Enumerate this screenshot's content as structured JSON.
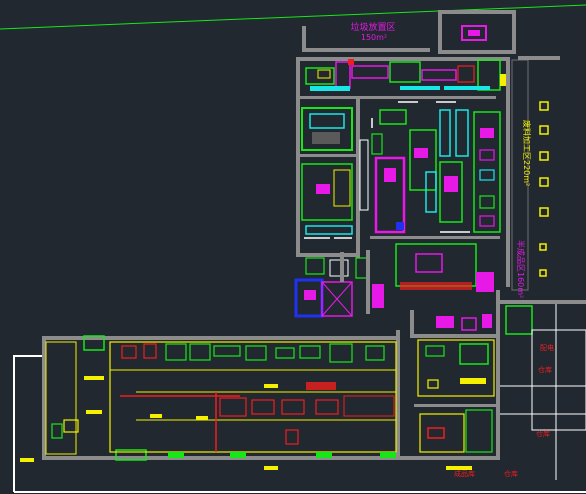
{
  "canvas": {
    "background": "#212830",
    "palette": {
      "wall": "#8c8c8c",
      "green": "#19e619",
      "yellow": "#f5f000",
      "magenta": "#e619e6",
      "cyan": "#19e6e6",
      "red": "#f01e1e",
      "white": "#ffffff",
      "blue": "#1e32f0",
      "grey_line": "#6e6e6e"
    }
  },
  "labels": {
    "waste_zone_line1": "垃圾放置区",
    "waste_zone_line2": "150m²",
    "right_zone_upper": "废料加工区220m²",
    "right_zone_lower": "半成品区160m²",
    "red_room_1": "配电",
    "red_room_2": "仓库",
    "red_room_3": "仓库",
    "bottom_red_1": "成品库",
    "bottom_red_2": "仓库"
  }
}
